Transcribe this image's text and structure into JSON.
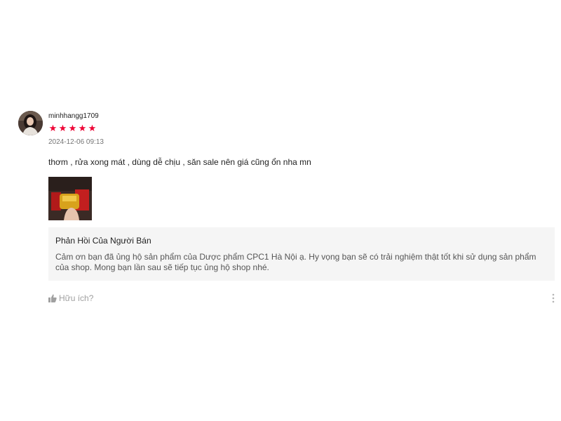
{
  "review": {
    "username": "minhhangg1709",
    "rating": 5,
    "stars": [
      "★",
      "★",
      "★",
      "★",
      "★"
    ],
    "timestamp": "2024-12-06 09:13",
    "comment": "thơm , rửa xong mát , dùng dễ chịu , săn sale nên giá cũng ổn nha mn",
    "star_color": "#ee0033"
  },
  "seller_reply": {
    "title": "Phản Hồi Của Người Bán",
    "text": "Cảm ơn bạn đã ủng hộ sản phẩm của Dược phẩm CPC1 Hà Nội ạ. Hy vọng bạn sẽ có trải nghiệm thật tốt khi sử dụng sản phẩm của shop. Mong bạn lần sau sẽ tiếp tục ủng hộ shop nhé."
  },
  "actions": {
    "helpful_label": "Hữu ích?",
    "helpful_icon": "thumbs-up-icon",
    "more_icon": "more-vertical-icon"
  }
}
